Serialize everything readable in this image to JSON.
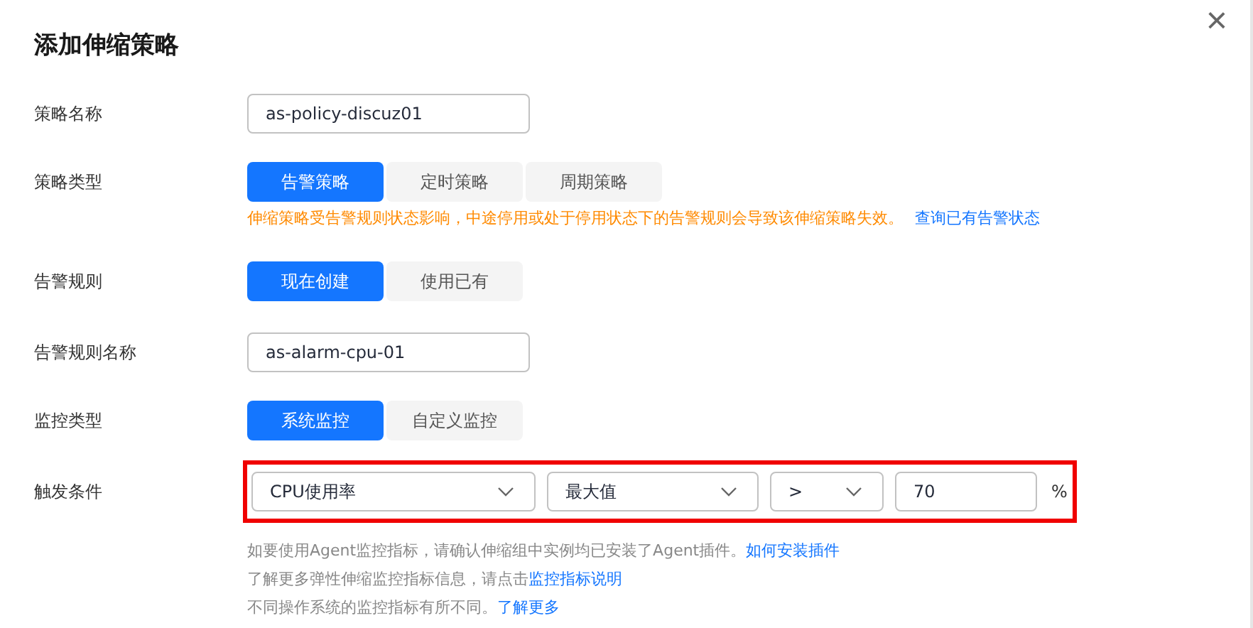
{
  "dialog": {
    "title": "添加伸缩策略",
    "close": "×"
  },
  "rows": [
    {
      "kind": "input",
      "label": "策略名称",
      "value": "as-policy-discuz01"
    },
    {
      "kind": "segmented",
      "label": "策略类型",
      "options": [
        {
          "label": "告警策略",
          "selected": true
        },
        {
          "label": "定时策略",
          "selected": false
        },
        {
          "label": "周期策略",
          "selected": false
        }
      ],
      "warning": "伸缩策略受告警规则状态影响，中途停用或处于停用状态下的告警规则会导致该伸缩策略失效。",
      "warning_link": "查询已有告警状态"
    },
    {
      "kind": "segmented",
      "label": "告警规则",
      "options": [
        {
          "label": "现在创建",
          "selected": true
        },
        {
          "label": "使用已有",
          "selected": false
        }
      ]
    },
    {
      "kind": "input",
      "label": "告警规则名称",
      "value": "as-alarm-cpu-01"
    },
    {
      "kind": "segmented",
      "label": "监控类型",
      "options": [
        {
          "label": "系统监控",
          "selected": true
        },
        {
          "label": "自定义监控",
          "selected": false
        }
      ]
    },
    {
      "kind": "trigger",
      "label": "触发条件",
      "highlighted": true,
      "metric": "CPU使用率",
      "aggregation": "最大值",
      "operator": ">",
      "threshold": "70",
      "unit": "%",
      "help": [
        {
          "text": "如要使用Agent监控指标，请确认伸缩组中实例均已安装了Agent插件。",
          "link": "如何安装插件"
        },
        {
          "text": "了解更多弹性伸缩监控指标信息，请点击",
          "link": "监控指标说明"
        },
        {
          "text": "不同操作系统的监控指标有所不同。",
          "link": "了解更多"
        }
      ]
    }
  ]
}
